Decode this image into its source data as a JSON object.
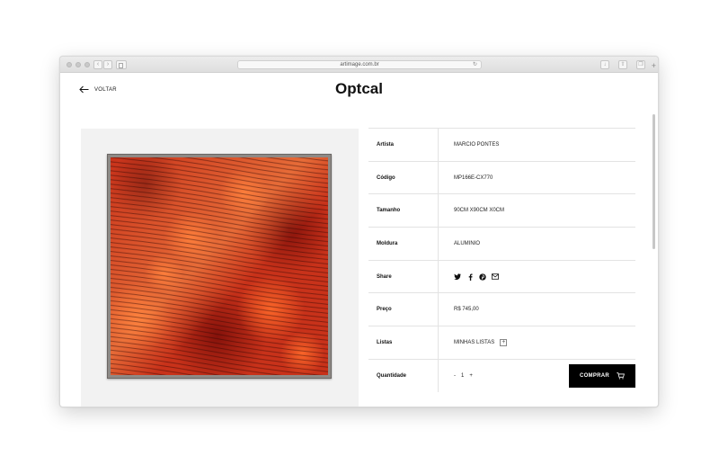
{
  "browser": {
    "url": "artimage.com.br"
  },
  "page": {
    "back_label": "VOLTAR",
    "title": "Optcal"
  },
  "specs": [
    {
      "label": "Artista",
      "value": "MARCIO PONTES"
    },
    {
      "label": "Código",
      "value": "MP166E-CX770"
    },
    {
      "label": "Tamanho",
      "value": "90CM X90CM X0CM"
    },
    {
      "label": "Moldura",
      "value": "ALUMINIO"
    },
    {
      "label": "Share",
      "value": ""
    },
    {
      "label": "Preço",
      "value": "R$ 745,00"
    },
    {
      "label": "Listas",
      "value": "MINHAS LISTAS"
    },
    {
      "label": "Quantidade",
      "value": ""
    }
  ],
  "share_icons": [
    "twitter-icon",
    "facebook-icon",
    "pinterest-icon",
    "email-icon"
  ],
  "quantity": {
    "minus": "-",
    "value": "1",
    "plus": "+"
  },
  "buy_button": {
    "label": "COMPRAR"
  },
  "colors": {
    "accent": "#000000",
    "artwork_base": "#c8321a"
  }
}
